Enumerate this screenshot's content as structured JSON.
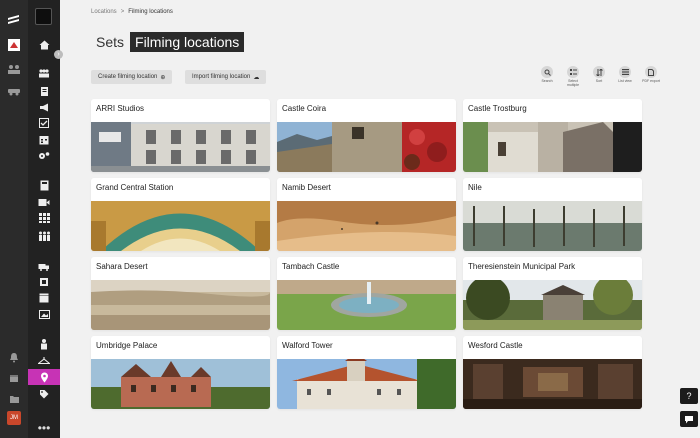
{
  "breadcrumb": {
    "root": "Locations",
    "separator": ">",
    "current": "Filming locations"
  },
  "header": {
    "prefix": "Sets",
    "title": "Filming locations"
  },
  "actions": {
    "create_label": "Create filming location",
    "import_label": "Import filming location"
  },
  "toolbar": [
    {
      "label": "Search",
      "icon": "search-icon"
    },
    {
      "label": "Select multiple",
      "icon": "select-multiple-icon"
    },
    {
      "label": "Sort",
      "icon": "sort-icon"
    },
    {
      "label": "List view",
      "icon": "list-view-icon"
    },
    {
      "label": "PDF export",
      "icon": "pdf-icon"
    }
  ],
  "locations": [
    {
      "name": "ARRI Studios"
    },
    {
      "name": "Castle Coira"
    },
    {
      "name": "Castle Trostburg"
    },
    {
      "name": "Grand Central Station"
    },
    {
      "name": "Namib Desert"
    },
    {
      "name": "Nile"
    },
    {
      "name": "Sahara Desert"
    },
    {
      "name": "Tambach Castle"
    },
    {
      "name": "Theresienstein Municipal Park"
    },
    {
      "name": "Umbridge Palace"
    },
    {
      "name": "Walford Tower"
    },
    {
      "name": "Wesford Castle"
    }
  ],
  "user": {
    "initials": "JM"
  },
  "accent_color": "#c733b5"
}
